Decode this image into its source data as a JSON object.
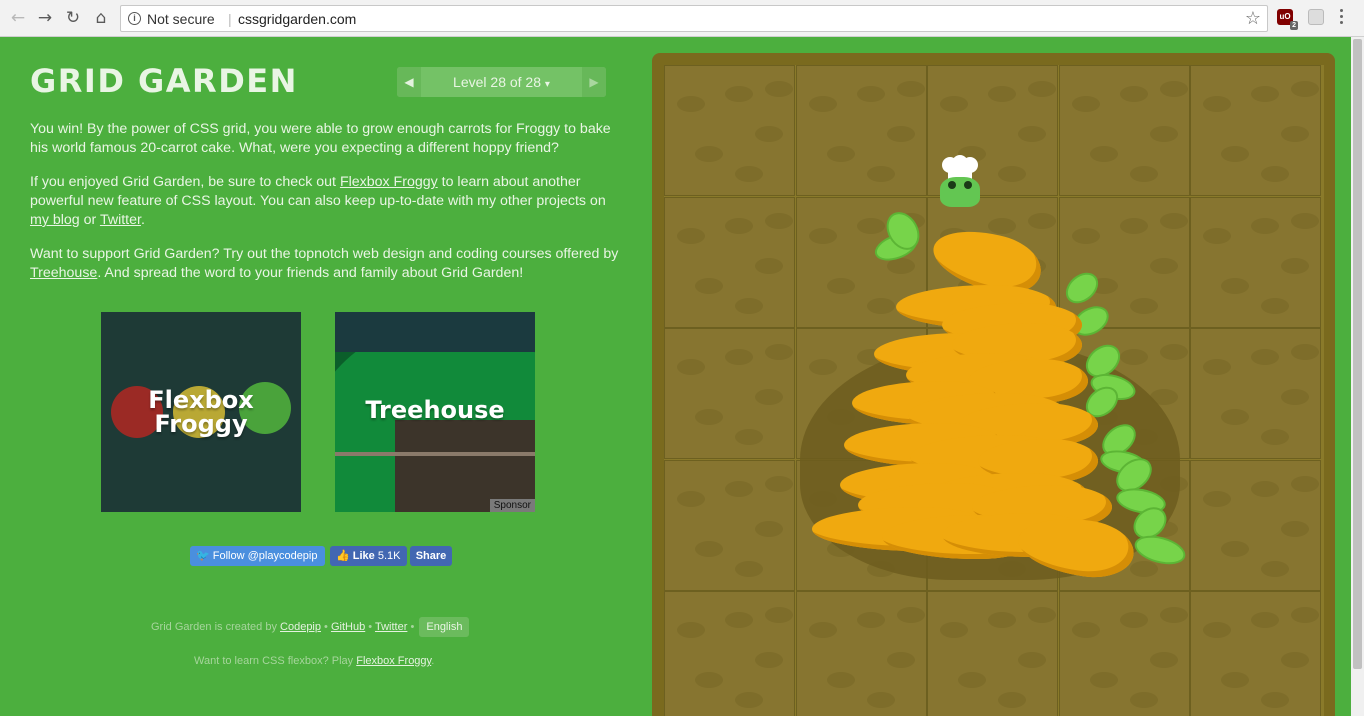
{
  "browser": {
    "security_label": "Not secure",
    "url": "cssgridgarden.com",
    "extension_badge": "2",
    "ublock_label": "uO"
  },
  "header": {
    "title": "GRID GARDEN",
    "level_label": "Level 28 of 28",
    "level_caret": "▾",
    "prev_icon": "◀",
    "next_icon": "▶"
  },
  "content": {
    "p1": "You win! By the power of CSS grid, you were able to grow enough carrots for Froggy to bake his world famous 20-carrot cake. What, were you expecting a different hoppy friend?",
    "p2_a": "If you enjoyed Grid Garden, be sure to check out ",
    "p2_link1": "Flexbox Froggy",
    "p2_b": " to learn about another powerful new feature of CSS layout. You can also keep up-to-date with my other projects on ",
    "p2_link2": "my blog",
    "p2_c": " or ",
    "p2_link3": "Twitter",
    "p2_d": ".",
    "p3_a": "Want to support Grid Garden? Try out the topnotch web design and coding courses offered by ",
    "p3_link": "Treehouse",
    "p3_b": ". And spread the word to your friends and family about Grid Garden!"
  },
  "promos": {
    "froggy_line1": "Flexbox",
    "froggy_line2": "Froggy",
    "treehouse": "Treehouse",
    "sponsor": "Sponsor"
  },
  "social": {
    "twitter": "Follow @playcodepip",
    "like": "Like",
    "like_count": "5.1K",
    "share": "Share"
  },
  "footer": {
    "created_by": "Grid Garden is created by ",
    "codepip": "Codepip",
    "dot": " • ",
    "github": "GitHub",
    "twitter": "Twitter",
    "language": "English",
    "learn": "Want to learn CSS flexbox? Play ",
    "flexbox_froggy": "Flexbox Froggy",
    "period": "."
  },
  "colors": {
    "background": "#4caf3e",
    "soil": "#877530",
    "carrot": "#f0a90f",
    "leaf": "#77d44a"
  }
}
